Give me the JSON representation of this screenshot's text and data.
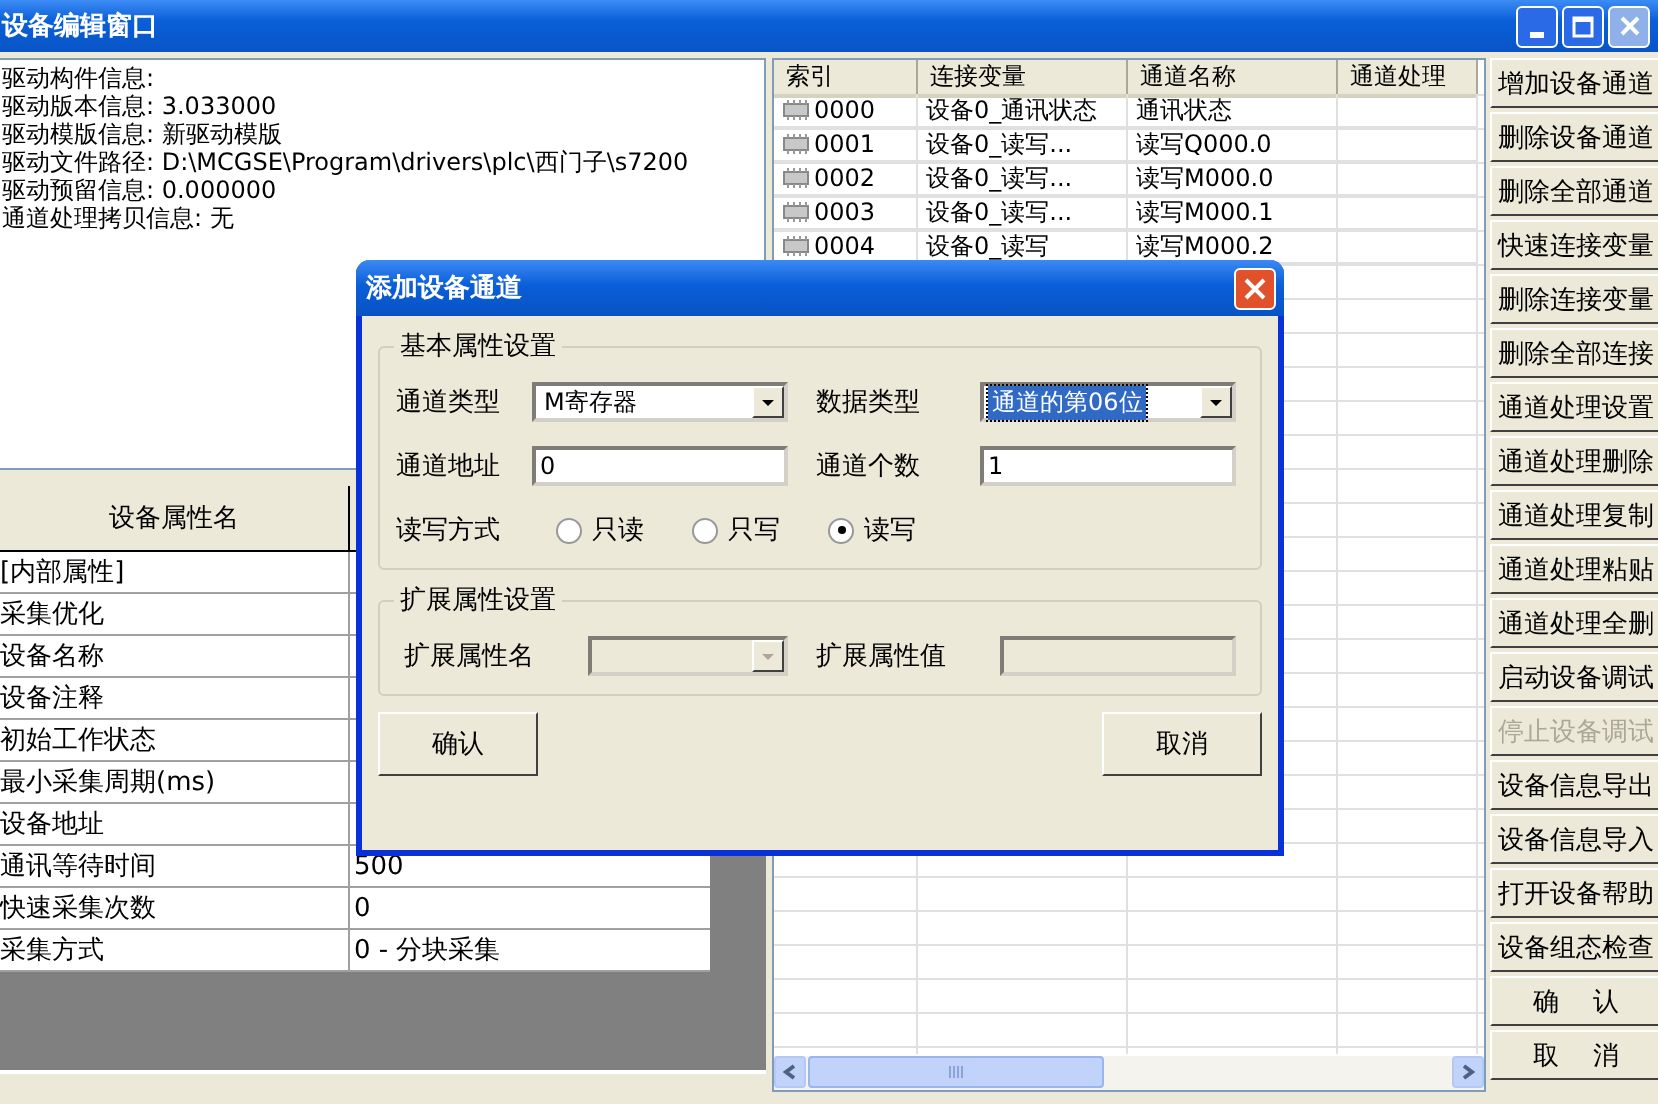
{
  "window": {
    "title": "设备编辑窗口"
  },
  "info_lines": [
    "驱动构件信息:",
    "驱动版本信息: 3.033000",
    "驱动模版信息: 新驱动模版",
    "驱动文件路径: D:\\MCGSE\\Program\\drivers\\plc\\西门子\\s7200",
    "驱动预留信息: 0.000000",
    "通道处理拷贝信息: 无"
  ],
  "properties": {
    "columns": [
      "设备属性名"
    ],
    "rows": [
      {
        "name": "[内部属性]"
      },
      {
        "name": "采集优化"
      },
      {
        "name": "设备名称"
      },
      {
        "name": "设备注释"
      },
      {
        "name": "初始工作状态"
      },
      {
        "name": "最小采集周期(ms)"
      },
      {
        "name": "设备地址"
      },
      {
        "name": "通讯等待时间",
        "value": "500"
      },
      {
        "name": "快速采集次数",
        "value": "0"
      },
      {
        "name": "采集方式",
        "value": "0 - 分块采集"
      }
    ]
  },
  "channels": {
    "columns": [
      "索引",
      "连接变量",
      "通道名称",
      "通道处理"
    ],
    "rows": [
      {
        "index": "0000",
        "variable": "设备0_通讯状态",
        "name": "通讯状态"
      },
      {
        "index": "0001",
        "variable": "设备0_读写...",
        "name": "读写Q000.0"
      },
      {
        "index": "0002",
        "variable": "设备0_读写...",
        "name": "读写M000.0"
      },
      {
        "index": "0003",
        "variable": "设备0_读写...",
        "name": "读写M000.1"
      },
      {
        "index": "0004",
        "variable": "设备0_读写",
        "name": "读写M000.2"
      }
    ]
  },
  "buttons": [
    {
      "label": "增加设备通道",
      "disabled": false
    },
    {
      "label": "删除设备通道",
      "disabled": false
    },
    {
      "label": "删除全部通道",
      "disabled": false
    },
    {
      "label": "快速连接变量",
      "disabled": false
    },
    {
      "label": "删除连接变量",
      "disabled": false
    },
    {
      "label": "删除全部连接",
      "disabled": false
    },
    {
      "label": "通道处理设置",
      "disabled": false
    },
    {
      "label": "通道处理删除",
      "disabled": false
    },
    {
      "label": "通道处理复制",
      "disabled": false
    },
    {
      "label": "通道处理粘贴",
      "disabled": false
    },
    {
      "label": "通道处理全删",
      "disabled": false
    },
    {
      "label": "启动设备调试",
      "disabled": false
    },
    {
      "label": "停止设备调试",
      "disabled": true
    },
    {
      "label": "设备信息导出",
      "disabled": false
    },
    {
      "label": "设备信息导入",
      "disabled": false
    },
    {
      "label": "打开设备帮助",
      "disabled": false
    },
    {
      "label": "设备组态检查",
      "disabled": false
    },
    {
      "label": "确    认",
      "disabled": false
    },
    {
      "label": "取    消",
      "disabled": false
    }
  ],
  "dialog": {
    "title": "添加设备通道",
    "basic_group": {
      "title": "基本属性设置",
      "channel_type": {
        "label": "通道类型",
        "value": "M寄存器",
        "focused": false
      },
      "data_type": {
        "label": "数据类型",
        "value": "通道的第06位",
        "focused": true
      },
      "address": {
        "label": "通道地址",
        "value": "0"
      },
      "count": {
        "label": "通道个数",
        "value": "1"
      },
      "rw_mode": {
        "label": "读写方式",
        "options": [
          {
            "label": "只读",
            "selected": false
          },
          {
            "label": "只写",
            "selected": false
          },
          {
            "label": "读写",
            "selected": true
          }
        ]
      }
    },
    "ext_group": {
      "title": "扩展属性设置",
      "name_field": {
        "label": "扩展属性名",
        "disabled": true
      },
      "value_field": {
        "label": "扩展属性值",
        "disabled": true
      }
    },
    "confirm": "确认",
    "cancel": "取消"
  }
}
